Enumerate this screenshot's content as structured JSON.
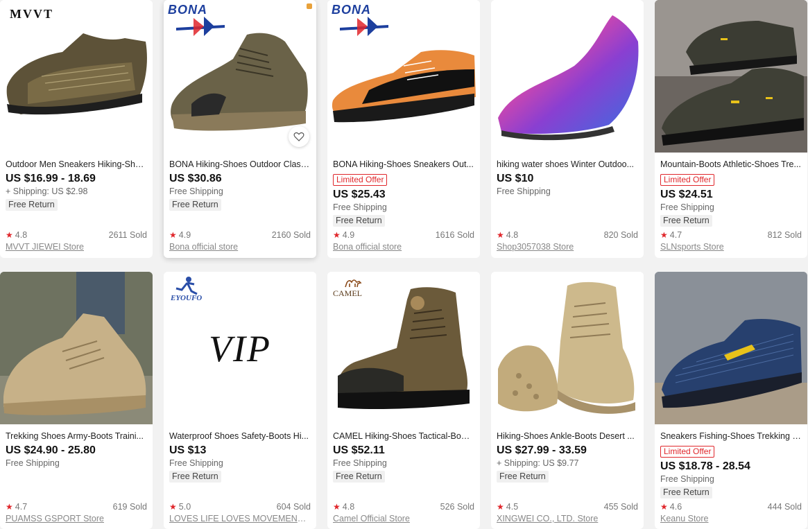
{
  "products": [
    {
      "title": "Outdoor Men Sneakers Hiking-Sho...",
      "badge": "",
      "price": "US $16.99 - 18.69",
      "shipping": "+ Shipping: US $2.98",
      "free_return": "Free Return",
      "rating": "4.8",
      "sold": "2611 Sold",
      "store": "MVVT JIEWEI Store",
      "brand": "MVVT",
      "image": "hiking-sneaker-icon"
    },
    {
      "title": "BONA Hiking-Shoes Outdoor Class...",
      "badge": "",
      "price": "US $30.86",
      "shipping": "Free Shipping",
      "free_return": "Free Return",
      "rating": "4.9",
      "sold": "2160 Sold",
      "store": "Bona official store",
      "brand": "BONA",
      "image": "hiking-shoe-icon"
    },
    {
      "title": "BONA Hiking-Shoes Sneakers Out...",
      "badge": "Limited Offer",
      "price": "US $25.43",
      "shipping": "Free Shipping",
      "free_return": "Free Return",
      "rating": "4.9",
      "sold": "1616 Sold",
      "store": "Bona official store",
      "brand": "BONA",
      "image": "orange-sneaker-icon"
    },
    {
      "title": "hiking water shoes Winter Outdoo...",
      "badge": "",
      "price": "US $10",
      "shipping": "Free Shipping",
      "free_return": "",
      "rating": "4.8",
      "sold": "820 Sold",
      "store": "Shop3057038 Store",
      "brand": "",
      "image": "water-shoe-icon"
    },
    {
      "title": "Mountain-Boots Athletic-Shoes Tre...",
      "badge": "Limited Offer",
      "price": "US $24.51",
      "shipping": "Free Shipping",
      "free_return": "Free Return",
      "rating": "4.7",
      "sold": "812 Sold",
      "store": "SLNsports Store",
      "brand": "",
      "image": "athletic-boot-icon"
    },
    {
      "title": "Trekking Shoes Army-Boots Traini...",
      "badge": "",
      "price": "US $24.90 - 25.80",
      "shipping": "Free Shipping",
      "free_return": "",
      "rating": "4.7",
      "sold": "619 Sold",
      "store": "PUAMSS GSPORT Store",
      "brand": "",
      "image": "trekking-shoe-icon"
    },
    {
      "title": "Waterproof Shoes Safety-Boots Hi...",
      "badge": "",
      "price": "US $13",
      "shipping": "Free Shipping",
      "free_return": "Free Return",
      "rating": "5.0",
      "sold": "604 Sold",
      "store": "LOVES LIFE LOVES MOVEMENT Store",
      "brand": "EYOUFO",
      "image": "vip-placeholder",
      "vip": "VIP"
    },
    {
      "title": "CAMEL Hiking-Shoes Tactical-Boot...",
      "badge": "",
      "price": "US $52.11",
      "shipping": "Free Shipping",
      "free_return": "Free Return",
      "rating": "4.8",
      "sold": "526 Sold",
      "store": "Camel Official Store",
      "brand": "CAMEL",
      "image": "high-boot-icon"
    },
    {
      "title": "Hiking-Shoes Ankle-Boots Desert ...",
      "badge": "",
      "price": "US $27.99 - 33.59",
      "shipping": "+ Shipping: US $9.77",
      "free_return": "Free Return",
      "rating": "4.5",
      "sold": "455 Sold",
      "store": "XINGWEI CO., LTD. Store",
      "brand": "",
      "image": "desert-boot-icon"
    },
    {
      "title": "Sneakers Fishing-Shoes Trekking O...",
      "badge": "Limited Offer",
      "price": "US $18.78 - 28.54",
      "shipping": "Free Shipping",
      "free_return": "Free Return",
      "rating": "4.6",
      "sold": "444 Sold",
      "store": "Keanu Store",
      "brand": "",
      "image": "blue-sneaker-icon"
    }
  ],
  "colors": {
    "accent": "#e0262b",
    "background": "#f2f2f2",
    "card": "#ffffff"
  }
}
